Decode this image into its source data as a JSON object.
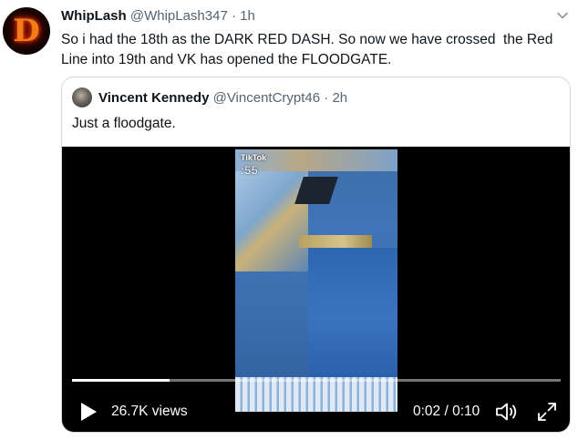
{
  "tweet": {
    "avatar_letter": "D",
    "display_name": "WhipLash",
    "handle": "@WhipLash347",
    "separator": "·",
    "time": "1h",
    "text_line1": "So i had the 18th as the DARK RED DASH. So now we have crossed  the Red",
    "text_line2": "Line into 19th and VK has opened the FLOODGATE."
  },
  "quote": {
    "display_name": "Vincent Kennedy",
    "handle": "@VincentCrypt46",
    "separator": "·",
    "time": "2h",
    "text": "Just a floodgate."
  },
  "video": {
    "watermark": "TikTok",
    "overlay_id": ":55",
    "views": "26.7K views",
    "time_display": "0:02 / 0:10",
    "progress": 0.2,
    "icons": {
      "play": "play-icon",
      "volume": "volume-icon",
      "fullscreen": "fullscreen-icon",
      "menu": "chevron-down-icon"
    }
  },
  "colors": {
    "text_primary": "#0f1419",
    "text_secondary": "#536471",
    "border": "#cfd9de",
    "media_bg": "#000000",
    "avatar_glow": "#f07d1a"
  }
}
